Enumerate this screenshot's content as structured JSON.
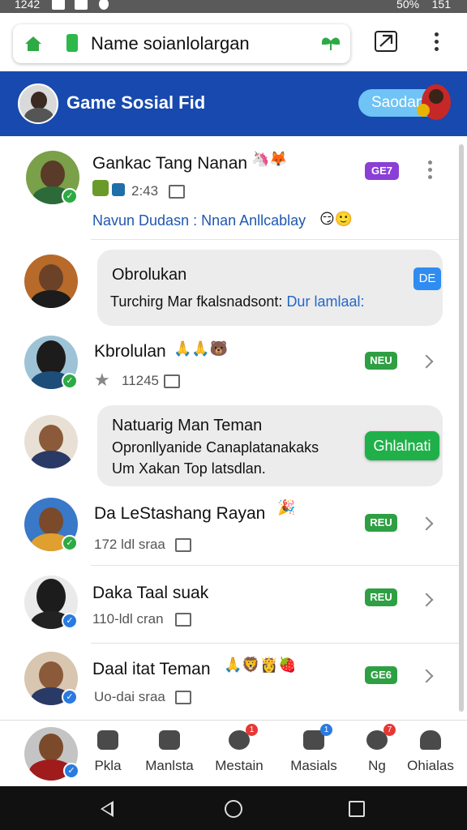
{
  "status_bar": {
    "time": "1242",
    "battery": "50%",
    "clock_right": "151"
  },
  "browser": {
    "url": "Name soianlolargan"
  },
  "header": {
    "title": "Game Sosial Fid",
    "pill_label": "Saodan"
  },
  "feed": {
    "item1": {
      "name": "Gankac Tang Nanan",
      "time": "2:43",
      "tag": "GE7",
      "link_text": "Navun Dudasn : Nnan Anllcablay",
      "name_emoji": "🦄🦊",
      "link_emoji": "😏🙂"
    },
    "item2": {
      "title": "Obrolukan",
      "text_prefix": "Turchirg Mar fkalsnadsont:",
      "text_link": "Dur lamlaal:",
      "tag": "DE"
    },
    "item3": {
      "name": "Kbrolulan",
      "count": "11245",
      "tag": "NEU",
      "name_emoji": "🙏🙏🐻"
    },
    "item4": {
      "title": "Natuarig Man Teman",
      "line1": "Opronllyanide Canaplatanakaks",
      "line2": "Um Xakan Top latsdlan.",
      "button": "Ghlalnati"
    },
    "item5": {
      "name": "Da LeStashang Rayan",
      "meta": "172 ldl sraa",
      "tag": "REU",
      "name_emoji": "🎉"
    },
    "item6": {
      "name": "Daka Taal suak",
      "meta": "110-ldl cran",
      "tag": "REU"
    },
    "item7": {
      "name": "Daal itat Teman",
      "meta": "Uo-dai sraa",
      "tag": "GE6",
      "name_emoji": "🙏🦁👸🍓"
    }
  },
  "bottom_nav": {
    "items": [
      {
        "label": "Pkla",
        "icon": "chat-icon",
        "badge": ""
      },
      {
        "label": "Manlsta",
        "icon": "list-icon",
        "badge": ""
      },
      {
        "label": "Mestain",
        "icon": "triangle-icon",
        "badge": "1"
      },
      {
        "label": "Masials",
        "icon": "message-icon",
        "badge": "1"
      },
      {
        "label": "Ng",
        "icon": "warning-icon",
        "badge": "7"
      },
      {
        "label": "Ohialas",
        "icon": "person-icon",
        "badge": ""
      }
    ]
  },
  "colors": {
    "header_bg": "#1749ae",
    "accent_green": "#2ea043",
    "link_blue": "#1f57b3",
    "tag_purple": "#8b3fd6"
  }
}
